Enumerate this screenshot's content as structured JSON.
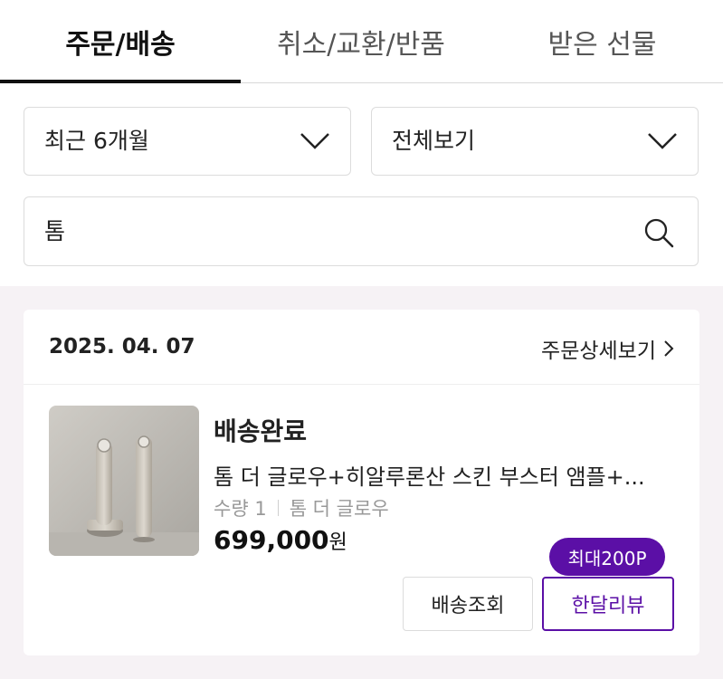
{
  "tabs": [
    {
      "label": "주문/배송"
    },
    {
      "label": "취소/교환/반품"
    },
    {
      "label": "받은 선물"
    }
  ],
  "filters": {
    "period": {
      "selected": "최근 6개월"
    },
    "type": {
      "selected": "전체보기"
    }
  },
  "search": {
    "value": "톰"
  },
  "order": {
    "date": "2025. 04. 07",
    "detail_link": "주문상세보기",
    "status": "배송완료",
    "product_name": "톰 더 글로우+히알루론산 스킨 부스터 앰플+...",
    "quantity": "수량 1",
    "option": "톰 더 글로우",
    "price": "699,000",
    "currency": "원",
    "buttons": {
      "track": "배송조회",
      "review": "한달리뷰"
    },
    "review_badge": "최대200P"
  },
  "colors": {
    "accent": "#5b0fa6",
    "section_bg": "#f6f2f5"
  },
  "icons": [
    "chevron-down-icon",
    "search-icon",
    "chevron-right-icon"
  ]
}
